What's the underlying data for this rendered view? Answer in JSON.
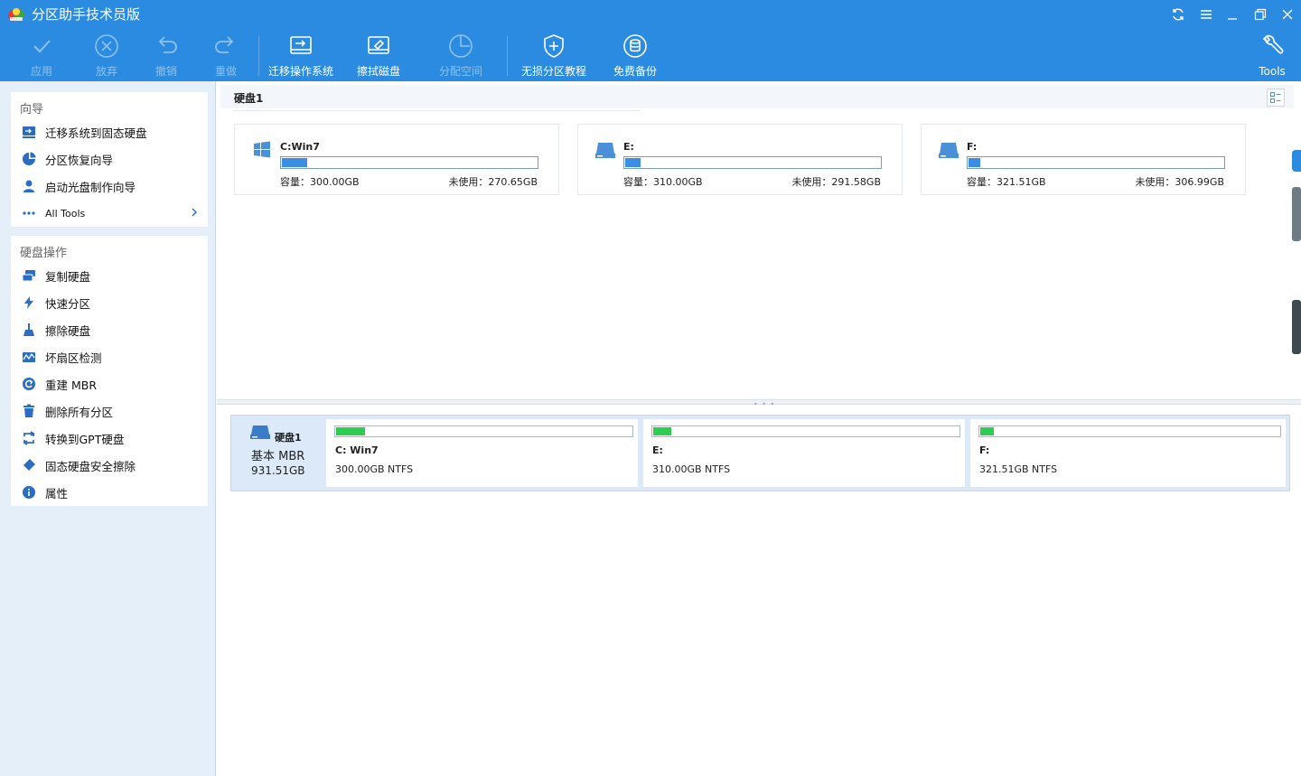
{
  "app": {
    "title": "分区助手技术员版"
  },
  "toolbar": {
    "apply": "应用",
    "discard": "放弃",
    "undo": "撤销",
    "redo": "重做",
    "migrate_os": "迁移操作系统",
    "wipe_disk": "擦拭磁盘",
    "allocate_space": "分配空间",
    "lossless_tutorial": "无损分区教程",
    "free_backup": "免费备份",
    "tools": "Tools"
  },
  "sidebar": {
    "wizard_title": "向导",
    "wizard_items": [
      "迁移系统到固态硬盘",
      "分区恢复向导",
      "启动光盘制作向导",
      "All Tools"
    ],
    "disk_ops_title": "硬盘操作",
    "disk_ops_items": [
      "复制硬盘",
      "快速分区",
      "擦除硬盘",
      "坏扇区检测",
      "重建 MBR",
      "删除所有分区",
      "转换到GPT硬盘",
      "固态硬盘安全擦除",
      "属性"
    ]
  },
  "main": {
    "disk_header": "硬盘1",
    "partitions": [
      {
        "name": "C:Win7",
        "capacity": "容量：300.00GB",
        "free": "未使用：270.65GB",
        "used_fraction": 0.098
      },
      {
        "name": "E:",
        "capacity": "容量：310.00GB",
        "free": "未使用：291.58GB",
        "used_fraction": 0.059
      },
      {
        "name": "F:",
        "capacity": "容量：321.51GB",
        "free": "未使用：306.99GB",
        "used_fraction": 0.045
      }
    ]
  },
  "disk_map": {
    "name": "硬盘1",
    "type": "基本 MBR",
    "size": "931.51GB",
    "partitions": [
      {
        "label": "C: Win7",
        "fs": "300.00GB NTFS",
        "used_fraction": 0.098
      },
      {
        "label": "E:",
        "fs": "310.00GB NTFS",
        "used_fraction": 0.059
      },
      {
        "label": "F:",
        "fs": "321.51GB NTFS",
        "used_fraction": 0.045
      }
    ]
  },
  "colors": {
    "accent": "#2b8be0",
    "used_bar": "#3c8ee5",
    "map_bar": "#2ecc52"
  }
}
